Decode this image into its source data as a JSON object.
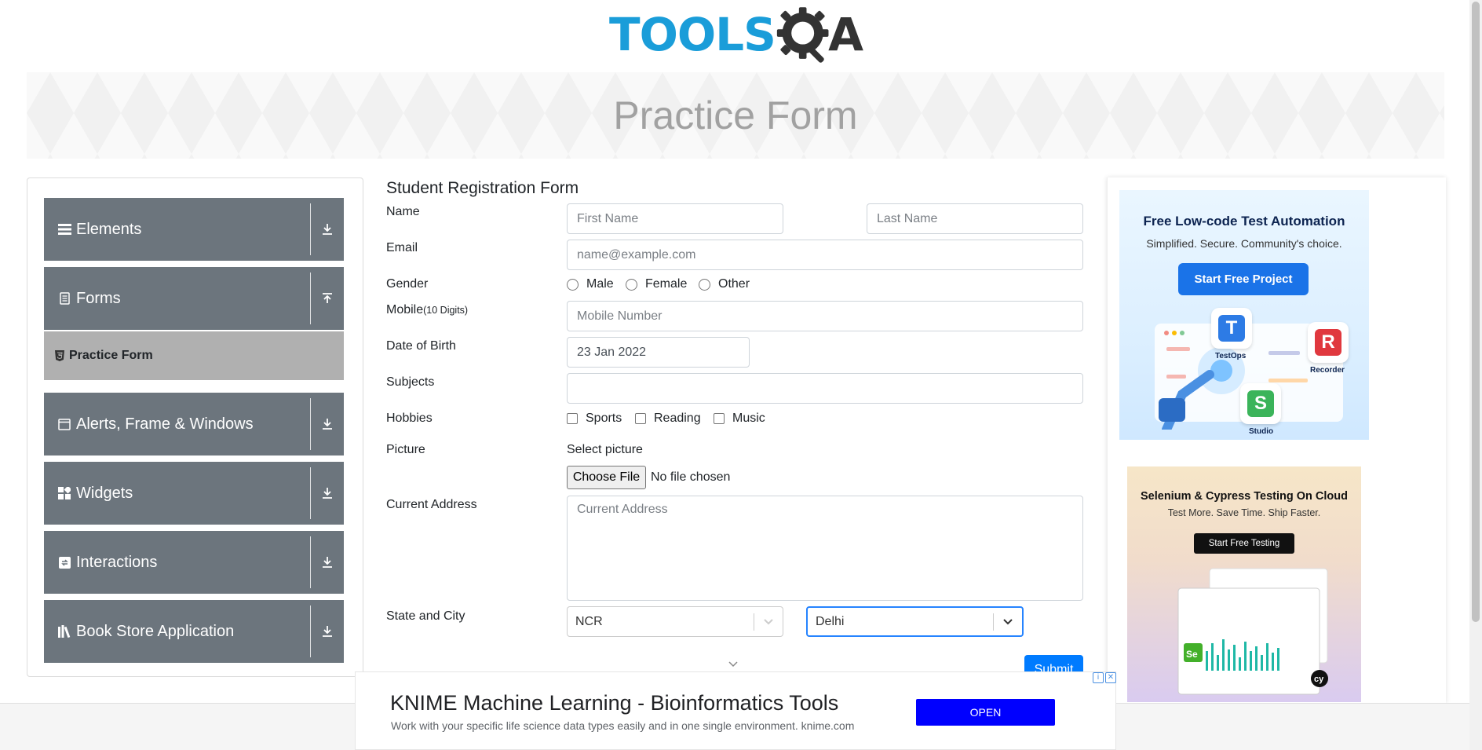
{
  "header": {
    "logo_main": "TOOLS",
    "logo_a": "A"
  },
  "banner": {
    "title": "Practice Form"
  },
  "sidebar": {
    "groups": [
      {
        "label": "Elements",
        "icon": "list-icon",
        "arrow": "download-icon"
      },
      {
        "label": "Forms",
        "icon": "document-icon",
        "arrow": "upload-icon"
      },
      {
        "label": "Alerts, Frame & Windows",
        "icon": "window-icon",
        "arrow": "download-icon"
      },
      {
        "label": "Widgets",
        "icon": "widgets-icon",
        "arrow": "download-icon"
      },
      {
        "label": "Interactions",
        "icon": "interactions-icon",
        "arrow": "download-icon"
      },
      {
        "label": "Book Store Application",
        "icon": "books-icon",
        "arrow": "download-icon"
      }
    ],
    "active_item": {
      "label": "Practice Form",
      "icon": "html5-icon"
    }
  },
  "form": {
    "title": "Student Registration Form",
    "name": {
      "label": "Name",
      "first_placeholder": "First Name",
      "last_placeholder": "Last Name"
    },
    "email": {
      "label": "Email",
      "placeholder": "name@example.com"
    },
    "gender": {
      "label": "Gender",
      "options": [
        "Male",
        "Female",
        "Other"
      ]
    },
    "mobile": {
      "label": "Mobile",
      "hint": "(10 Digits)",
      "placeholder": "Mobile Number"
    },
    "dob": {
      "label": "Date of Birth",
      "value": "23 Jan 2022"
    },
    "subjects": {
      "label": "Subjects",
      "value": ""
    },
    "hobbies": {
      "label": "Hobbies",
      "options": [
        "Sports",
        "Reading",
        "Music"
      ]
    },
    "picture": {
      "label": "Picture",
      "select_label": "Select picture",
      "button": "Choose File",
      "status": "No file chosen"
    },
    "address": {
      "label": "Current Address",
      "placeholder": "Current Address"
    },
    "state_city": {
      "label": "State and City",
      "state": "NCR",
      "city": "Delhi"
    },
    "submit": "Submit"
  },
  "ads": {
    "katalon": {
      "title": "Free Low-code Test Automation",
      "subtitle": "Simplified. Secure. Community's choice.",
      "button": "Start Free Project",
      "apps": [
        "TestOps",
        "Recorder",
        "Studio"
      ]
    },
    "lambdatest": {
      "title": "Selenium & Cypress Testing On Cloud",
      "subtitle": "Test More. Save Time. Ship Faster.",
      "button": "Start Free Testing"
    },
    "bottom": {
      "title": "KNIME Machine Learning - Bioinformatics Tools",
      "text": "Work with your specific life science data types easily and in one single environment. knime.com",
      "button": "OPEN"
    }
  },
  "colors": {
    "accent": "#1a9dd9",
    "sidebar_group": "#6c757d",
    "sidebar_active": "#b0b0b0",
    "primary": "#007bff",
    "ad_button": "#0000ff"
  }
}
